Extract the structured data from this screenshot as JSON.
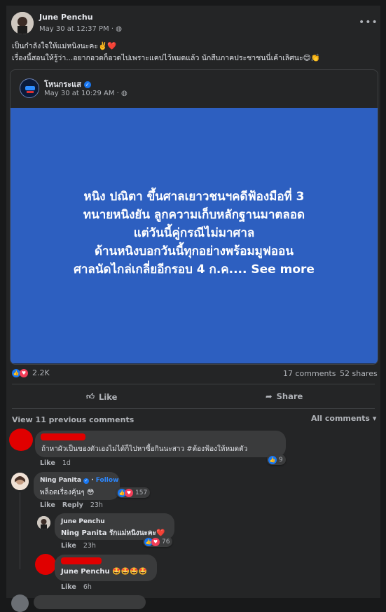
{
  "post": {
    "author": "June Penchu",
    "timestamp": "May 30 at 12:37 PM · ",
    "text_line1": "เป็นกำลังใจให้แม่หนิงนะคะ✌️❤️",
    "text_line2": "เรื่องนี้สอนให้รู้ว่า...อยากอวดก็อวดไปเพราะแคปไว้หมดแล้ว นักสืบภาคประชาชนนี่เค้าเลิศนะ😊👏",
    "shared": {
      "page_name": "โหนกระแส",
      "timestamp": "May 30 at 10:29 AM · ",
      "headline": [
        "หนิง ปณิตา ขึ้นศาลเยาวชนฯคดีฟ้องมือที่ 3",
        "ทนายหนิงยัน ลูกความเก็บหลักฐานมาตลอด",
        "แต่วันนี้คู่กรณีไม่มาศาล",
        "ด้านหนิงบอกวันนี้ทุกอย่างพร้อมมูฟออน",
        "ศาลนัดไกล่เกลี่ยอีกรอบ 4 ก.ค.... See more"
      ]
    },
    "reactions_count": "2.2K",
    "comments_count": "17 comments",
    "shares_count": "52 shares",
    "like_label": "Like",
    "share_label": "Share"
  },
  "comments_section": {
    "view_previous": "View 11 previous comments",
    "sort_label": "All comments"
  },
  "comments": [
    {
      "text": "ถ้าหาผัวเป็นของตัวเองไม่ได้ก็ไปหาซื้อกินนะสาว #ต้องฟ้องให้หมดตัว",
      "like": "Like",
      "time": "1d",
      "reactions": "9"
    },
    {
      "author": "Ning Panita",
      "follow": "Follow",
      "text": "พล็อตเรื่องคุ้นๆ 😳",
      "like": "Like",
      "reply": "Reply",
      "time": "23h",
      "reactions": "157"
    },
    {
      "author": "June Penchu",
      "text": "Ning Panita รักแม่หนิงนะคะ❤️",
      "like": "Like",
      "time": "23h",
      "reactions": "76"
    },
    {
      "text": "June Penchu 🤩🤩🤩🤩",
      "like": "Like",
      "time": "6h"
    }
  ],
  "colors": {
    "background": "#18191a",
    "card": "#242526",
    "shared_image_blue": "#2d5fc0",
    "redaction": "#e00000",
    "verified_blue": "#1877f2"
  }
}
